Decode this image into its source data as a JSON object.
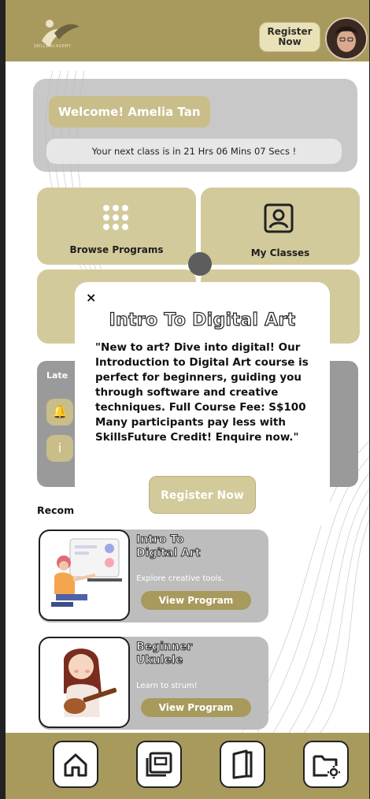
{
  "header": {
    "logo_text": "SKILLS ACADEMY",
    "register_label": "Register\nNow"
  },
  "welcome": {
    "title": "Welcome! Amelia Tan",
    "next_class": "Your next class is in 21 Hrs 06 Mins 07 Secs !"
  },
  "tiles": [
    {
      "label": "Browse Programs",
      "icon": "grid-icon"
    },
    {
      "label": "My Classes",
      "icon": "user-card-icon"
    }
  ],
  "latest": {
    "label": "Late",
    "icons": [
      "bell-icon",
      "info-icon"
    ]
  },
  "recommended_label": "Recom",
  "programs": [
    {
      "title": "Intro To\nDigital Art",
      "subtitle": "Explore creative tools.",
      "button": "View Program"
    },
    {
      "title": "Beginner\nUkulele",
      "subtitle": "Learn to strum!",
      "button": "View Program"
    }
  ],
  "modal": {
    "close": "×",
    "title": "Intro To Digital Art",
    "body": "\"New to art? Dive into digital! Our Introduction to Digital Art course is perfect for beginners, guiding you through software and creative techniques. Full Course Fee: S$100 Many participants pay less with SkillsFuture Credit! Enquire now.\"",
    "button": "Register Now"
  },
  "nav": [
    "home-icon",
    "courses-icon",
    "book-icon",
    "settings-folder-icon"
  ],
  "colors": {
    "brand": "#a89a5c",
    "tile": "#d3ca9c",
    "card_gray": "#bdbdbd"
  }
}
